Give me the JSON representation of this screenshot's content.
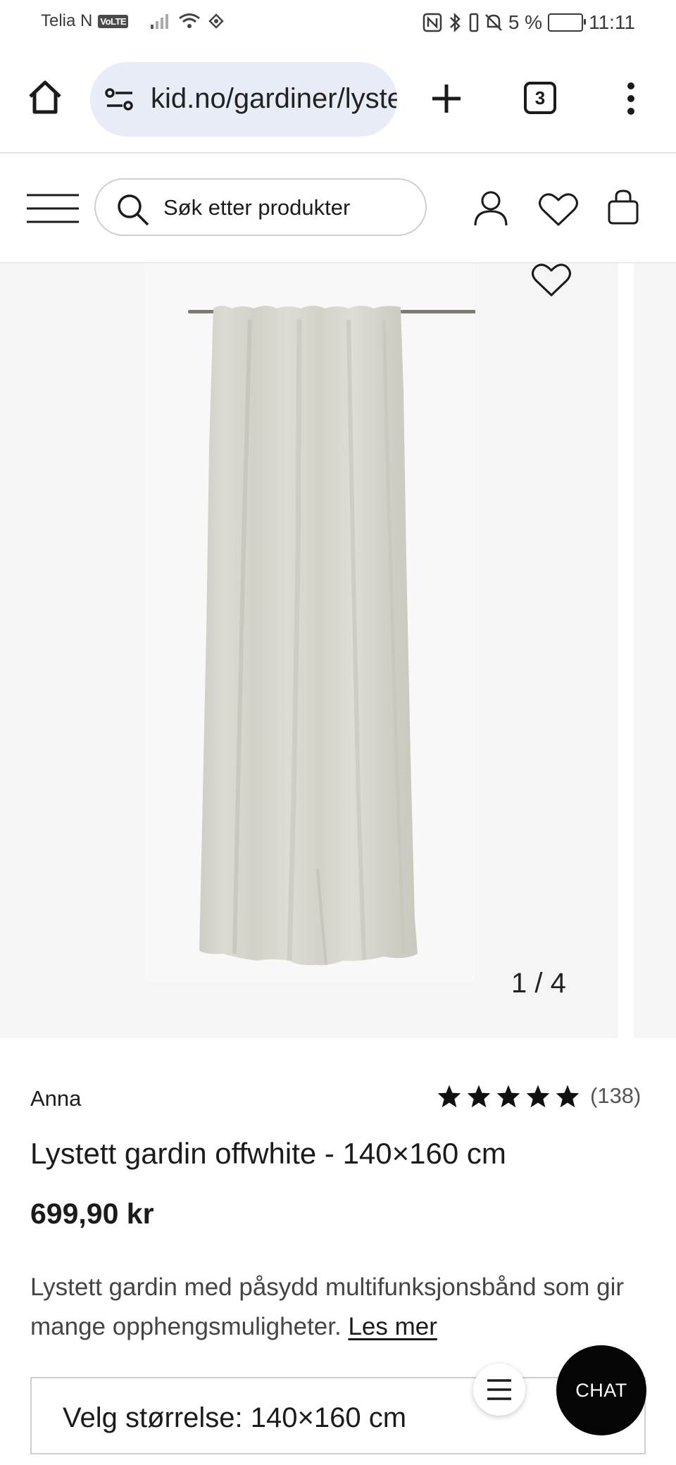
{
  "status_bar": {
    "carrier": "Telia N",
    "volte": "VoLTE",
    "battery": "5 %",
    "time": "11:11"
  },
  "browser": {
    "url": "kid.no/gardiner/lystett-gardin-offwhite",
    "tab_count": "3",
    "icons": [
      "home-icon",
      "site-settings-icon",
      "new-tab-icon",
      "tab-switcher-icon",
      "more-icon"
    ]
  },
  "site_header": {
    "search_placeholder": "Søk etter produkter",
    "icons": [
      "menu-icon",
      "search-icon",
      "account-icon",
      "wishlist-icon",
      "cart-icon"
    ]
  },
  "gallery": {
    "current": "1 / 4"
  },
  "product": {
    "brand": "Anna",
    "rating_stars": 5,
    "review_count": "(138)",
    "title": "Lystett gardin offwhite - 140×160 cm",
    "price": "699,90 kr",
    "description": "Lystett gardin med påsydd multifunksjonsbånd som gir mange opphengsmuligheter.",
    "read_more": "Les mer",
    "size_label": "Velg størrelse: 140×160 cm"
  },
  "chat": {
    "label": "CHAT"
  },
  "colors": {
    "url_bar_bg": "#e7ecf6",
    "image_bg": "#f5f5f5",
    "curtain": "#d9d8d0",
    "chat_bg": "#050505"
  }
}
